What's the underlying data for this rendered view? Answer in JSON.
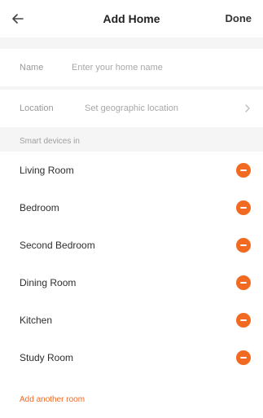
{
  "header": {
    "title": "Add Home",
    "done_label": "Done"
  },
  "form": {
    "name_label": "Name",
    "name_placeholder": "Enter your home name",
    "location_label": "Location",
    "location_placeholder": "Set geographic location"
  },
  "rooms": {
    "section_label": "Smart devices in",
    "items": [
      {
        "name": "Living Room"
      },
      {
        "name": "Bedroom"
      },
      {
        "name": "Second Bedroom"
      },
      {
        "name": "Dining Room"
      },
      {
        "name": "Kitchen"
      },
      {
        "name": "Study Room"
      }
    ],
    "add_label": "Add another room"
  },
  "colors": {
    "accent": "#f26a22",
    "section_bg": "#f5f5f5"
  },
  "icons": {
    "back": "arrow-left-icon",
    "location_chevron": "chevron-right-icon",
    "remove": "minus-circle-icon"
  }
}
